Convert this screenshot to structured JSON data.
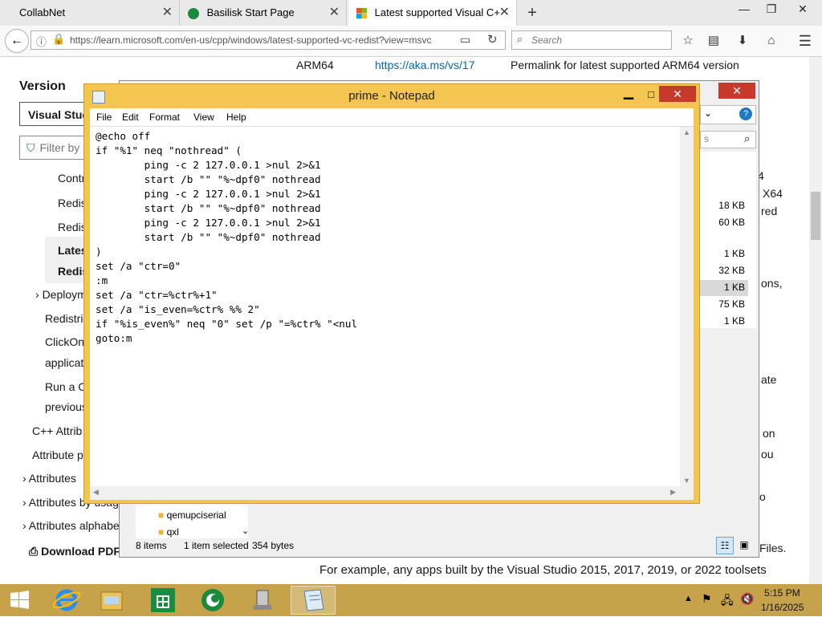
{
  "browser": {
    "tabs": [
      {
        "label": "CollabNet"
      },
      {
        "label": "Basilisk Start Page"
      },
      {
        "label": "Latest supported Visual C+"
      }
    ],
    "url": "https://learn.microsoft.com/en-us/cpp/windows/latest-supported-vc-redist?view=msvc",
    "search_placeholder": "Search"
  },
  "webpage": {
    "version_heading": "Version",
    "version_select": "Visual Stud",
    "filter_placeholder": "Filter by",
    "toc": [
      "Contr",
      "Redis",
      "Redis",
      "Lates",
      "Redis",
      "Deploym",
      "Redistrib",
      "ClickOn",
      "applicat",
      "Run a C",
      "previous",
      "C++ Attrib",
      "Attribute p",
      "Attributes",
      "Attributes by usage",
      "Attributes alphabe"
    ],
    "download_pdf": "Download PDF",
    "table_arch": "ARM64",
    "table_link": "https://aka.ms/vs/17",
    "table_desc": "Permalink for latest supported ARM64 version",
    "right_fragments": [
      "4",
      "X64",
      "red",
      "ons,",
      "ate",
      "on",
      "ou",
      "o",
      "Files."
    ],
    "bottom_sentence": "For example, any apps built by the Visual Studio 2015, 2017, 2019, or 2022 toolsets"
  },
  "explorer": {
    "sizes": [
      "18 KB",
      "60 KB",
      "1 KB",
      "32 KB",
      "1 KB",
      "75 KB",
      "1 KB"
    ],
    "folders": [
      "qemupciserial",
      "qxl"
    ],
    "status_items": "8 items",
    "status_selected": "1 item selected",
    "status_bytes": "354 bytes"
  },
  "notepad": {
    "title": "prime - Notepad",
    "menu": [
      "File",
      "Edit",
      "Format",
      "View",
      "Help"
    ],
    "content": "@echo off\nif \"%1\" neq \"nothread\" (\n        ping -c 2 127.0.0.1 >nul 2>&1\n        start /b \"\" \"%~dpf0\" nothread\n        ping -c 2 127.0.0.1 >nul 2>&1\n        start /b \"\" \"%~dpf0\" nothread\n        ping -c 2 127.0.0.1 >nul 2>&1\n        start /b \"\" \"%~dpf0\" nothread\n)\nset /a \"ctr=0\"\n:m\nset /a \"ctr=%ctr%+1\"\nset /a \"is_even=%ctr% %% 2\"\nif \"%is_even%\" neq \"0\" set /p \"=%ctr% \"<nul\ngoto:m"
  },
  "taskbar": {
    "time": "5:15 PM",
    "date": "1/16/2025"
  },
  "colors": {
    "notepad_frame": "#f5c552",
    "taskbar": "#c6a24a",
    "close_red": "#c7392b"
  }
}
